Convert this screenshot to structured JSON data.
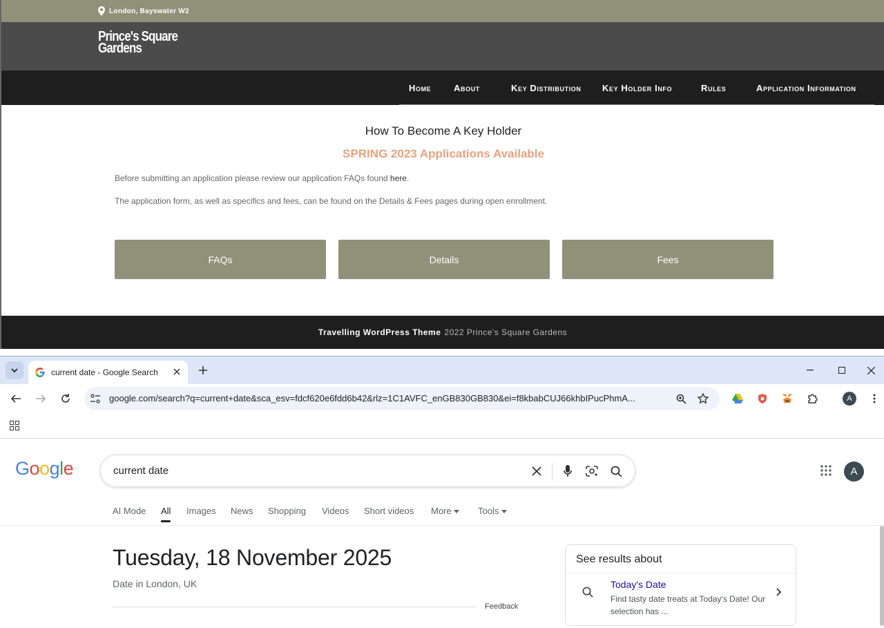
{
  "site": {
    "location": "London, Bayswater W2",
    "brand_line1": "Prince's Square",
    "brand_line2": "Gardens",
    "nav": [
      "Home",
      "About",
      "Key Distribution",
      "Key Holder Info",
      "Rules",
      "Application Information"
    ],
    "heading": "How To Become A Key Holder",
    "subheading": "SPRING 2023 Applications Available",
    "para1_text": "Before submitting an application please review our application FAQs found ",
    "para1_link": "here",
    "para1_end": ".",
    "para2": "The application form, as well as specifics and fees, can be found on the Details & Fees pages during open enrollment.",
    "buttons": [
      "FAQs",
      "Details",
      "Fees"
    ],
    "footer_theme": "Travelling WordPress Theme",
    "footer_copy": "2022 Prince's Square Gardens",
    "colors": {
      "olive": "#8f9179",
      "dark": "#1e1e1e",
      "accent": "#e9a27d"
    }
  },
  "browser": {
    "tab_title": "current date - Google Search",
    "url": "google.com/search?q=current+date&sca_esv=fdcf620e6fdd6b42&rlz=1C1AVFC_enGB830GB830&ei=f8kbabCUJ66khbIPucPhmA...",
    "profile_initial": "A"
  },
  "google": {
    "logo_letters": [
      "G",
      "o",
      "o",
      "g",
      "l",
      "e"
    ],
    "logo_colors": [
      "#4285F4",
      "#EA4335",
      "#FBBC05",
      "#4285F4",
      "#34A853",
      "#EA4335"
    ],
    "query": "current date",
    "tabs": [
      "AI Mode",
      "All",
      "Images",
      "News",
      "Shopping",
      "Videos",
      "Short videos",
      "More",
      "Tools"
    ],
    "active_tab": "All",
    "date": "Tuesday, 18 November 2025",
    "location": "Date in London, UK",
    "feedback": "Feedback",
    "panel_heading": "See results about",
    "panel_title": "Today's Date",
    "panel_desc": "Find tasty date treats at Today's Date! Our selection has ...",
    "avatar_initial": "A"
  }
}
